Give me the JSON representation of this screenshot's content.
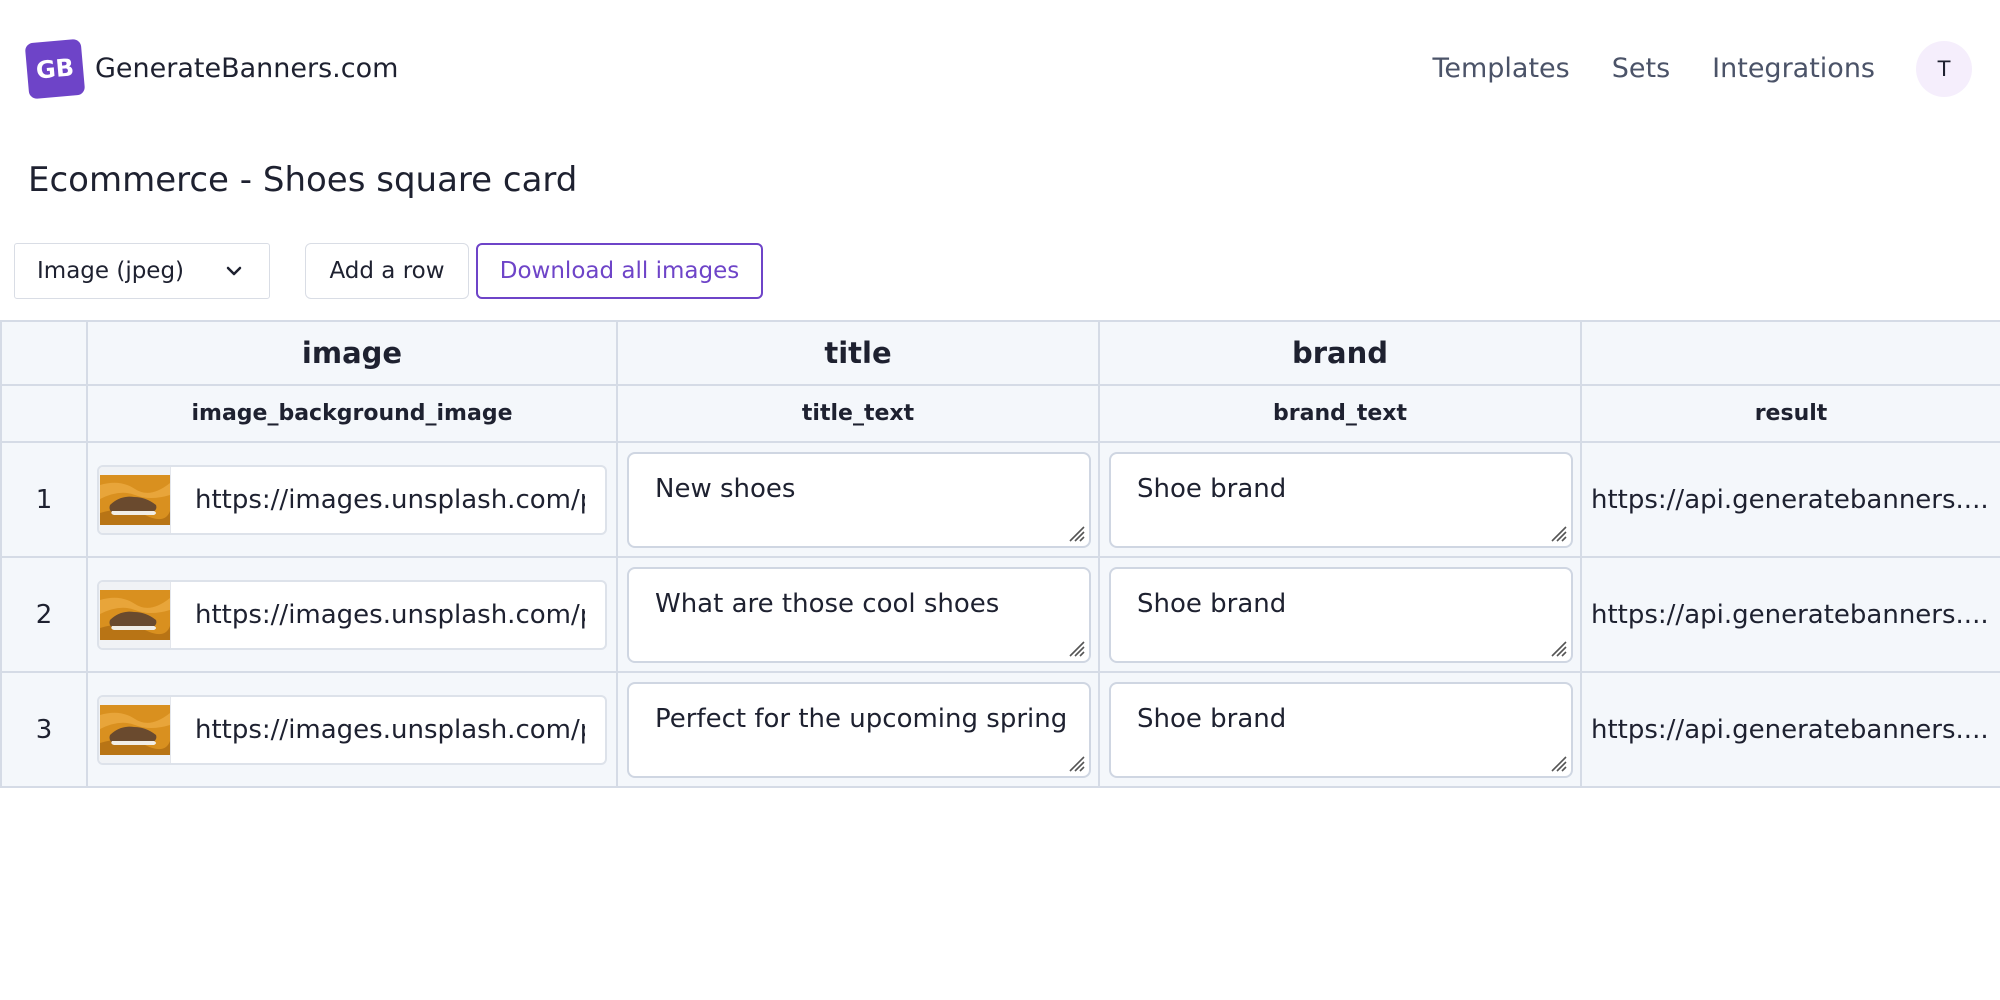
{
  "header": {
    "logo_text": "GB",
    "brand": "GenerateBanners.com",
    "nav": [
      "Templates",
      "Sets",
      "Integrations"
    ],
    "avatar_initial": "T",
    "accent_color": "#6e44c8"
  },
  "page": {
    "title": "Ecommerce - Shoes square card"
  },
  "toolbar": {
    "format_selected": "Image (jpeg)",
    "add_row_label": "Add a row",
    "download_label": "Download all images"
  },
  "table": {
    "groups": [
      "image",
      "title",
      "brand"
    ],
    "columns": [
      "image_background_image",
      "title_text",
      "brand_text",
      "result"
    ],
    "rows": [
      {
        "number": "1",
        "image_url": "https://images.unsplash.com/p",
        "title_text": "New shoes",
        "brand_text": "Shoe brand",
        "result": "https://api.generatebanners...."
      },
      {
        "number": "2",
        "image_url": "https://images.unsplash.com/p",
        "title_text": "What are those cool shoes",
        "brand_text": "Shoe brand",
        "result": "https://api.generatebanners...."
      },
      {
        "number": "3",
        "image_url": "https://images.unsplash.com/p",
        "title_text": "Perfect for the upcoming spring",
        "brand_text": "Shoe brand",
        "result": "https://api.generatebanners...."
      }
    ]
  }
}
